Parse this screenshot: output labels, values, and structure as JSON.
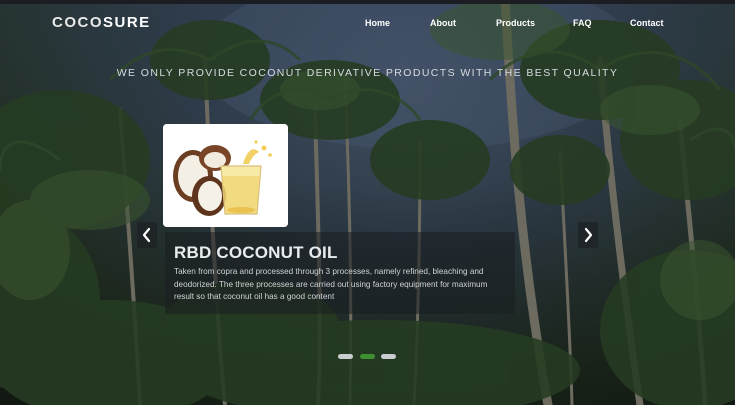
{
  "brand": {
    "logo_main": "COCO",
    "logo_accent": "SURE"
  },
  "nav": {
    "items": [
      "Home",
      "About",
      "Products",
      "FAQ",
      "Contact"
    ]
  },
  "hero": {
    "tagline": "WE ONLY PROVIDE COCONUT DERIVATIVE PRODUCTS WITH THE BEST QUALITY"
  },
  "slide": {
    "title": "RBD COCONUT OIL",
    "description": "Taken from copra and processed through 3 processes, namely refined, bleaching and deodorized. The three processes are carried out using factory equipment for maximum result so that coconut oil has a good content",
    "prev_icon": "chevron-left-icon",
    "next_icon": "chevron-right-icon"
  },
  "carousel": {
    "slide_count": 3,
    "active_index": 1,
    "active_color": "#3d8f2f",
    "inactive_color": "#c9cdd0"
  }
}
